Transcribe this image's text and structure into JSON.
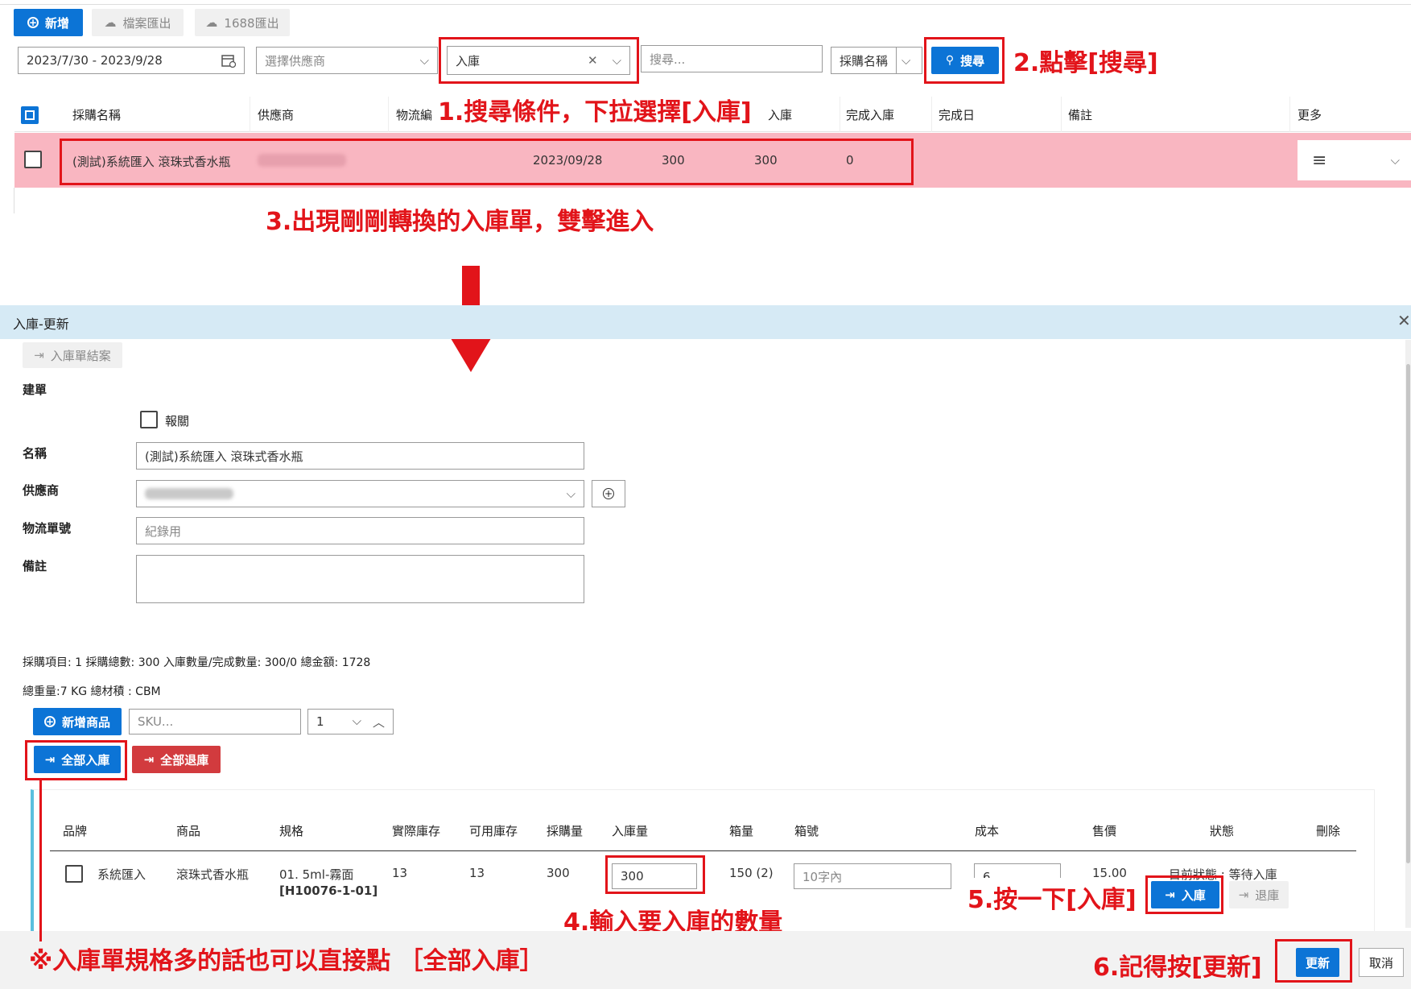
{
  "toolbar": {
    "add_label": "新增",
    "export_file_label": "檔案匯出",
    "export_1688_label": "1688匯出"
  },
  "filters": {
    "date_range": "2023/7/30 - 2023/9/28",
    "supplier_placeholder": "選擇供應商",
    "status_value": "入庫",
    "search_placeholder": "搜尋...",
    "search_field": "採購名稱",
    "search_button": "搜尋"
  },
  "list_table": {
    "headers": [
      "採購名稱",
      "供應商",
      "物流編",
      "入庫",
      "完成入庫",
      "完成日",
      "備註",
      "更多"
    ],
    "row": {
      "name": "(測試)系統匯入 滾珠式香水瓶",
      "date": "2023/09/28",
      "qty1": "300",
      "qty2": "300",
      "done": "0"
    }
  },
  "annotations": {
    "step1": "1.搜尋條件，下拉選擇[入庫]",
    "step2": "2.點擊[搜尋]",
    "step3": "3.出現剛剛轉換的入庫單，雙擊進入",
    "step4": "4.輸入要入庫的數量",
    "step5": "5.按一下[入庫]",
    "step6": "6.記得按[更新]",
    "tip": "※入庫單規格多的話也可以直接點 ［全部入庫］"
  },
  "dialog": {
    "title": "入庫-更新",
    "close_order_label": "入庫單結案",
    "section_create": "建單",
    "customs_label": "報關",
    "name_label": "名稱",
    "name_value": "(測試)系統匯入 滾珠式香水瓶",
    "supplier_label": "供應商",
    "tracking_label": "物流單號",
    "tracking_placeholder": "紀錄用",
    "remark_label": "備註",
    "summary_line1": "採購項目: 1  採購總數: 300  入庫數量/完成數量: 300/0  總金額: 1728",
    "summary_line2": "總重量:7 KG  總材積 : CBM",
    "add_product_label": "新增商品",
    "sku_placeholder": "SKU...",
    "qty_value": "1",
    "all_in_label": "全部入庫",
    "all_return_label": "全部退庫",
    "item_headers": [
      "品牌",
      "商品",
      "規格",
      "實際庫存",
      "可用庫存",
      "採購量",
      "入庫量",
      "箱量",
      "箱號",
      "成本",
      "售價",
      "狀態",
      "刪除"
    ],
    "item": {
      "brand": "系統匯入",
      "product": "滾珠式香水瓶",
      "spec": "01. 5ml-霧面",
      "sku_code": "[H10076-1-01]",
      "actual_stock": "13",
      "available_stock": "13",
      "purchase_qty": "300",
      "in_qty": "300",
      "box_qty": "150 (2)",
      "box_no_placeholder": "10字內",
      "cost": "6",
      "price": "15.00",
      "status": "目前狀態 : 等待入庫",
      "in_button": "入庫",
      "return_button": "退庫"
    },
    "update_button": "更新",
    "cancel_button": "取消"
  },
  "colors": {
    "primary": "#0c74d6",
    "highlight_row": "#f9b6c1",
    "annotation_red": "#e2141a",
    "danger": "#d23b3e",
    "dialog_header": "#d6eaf5"
  }
}
